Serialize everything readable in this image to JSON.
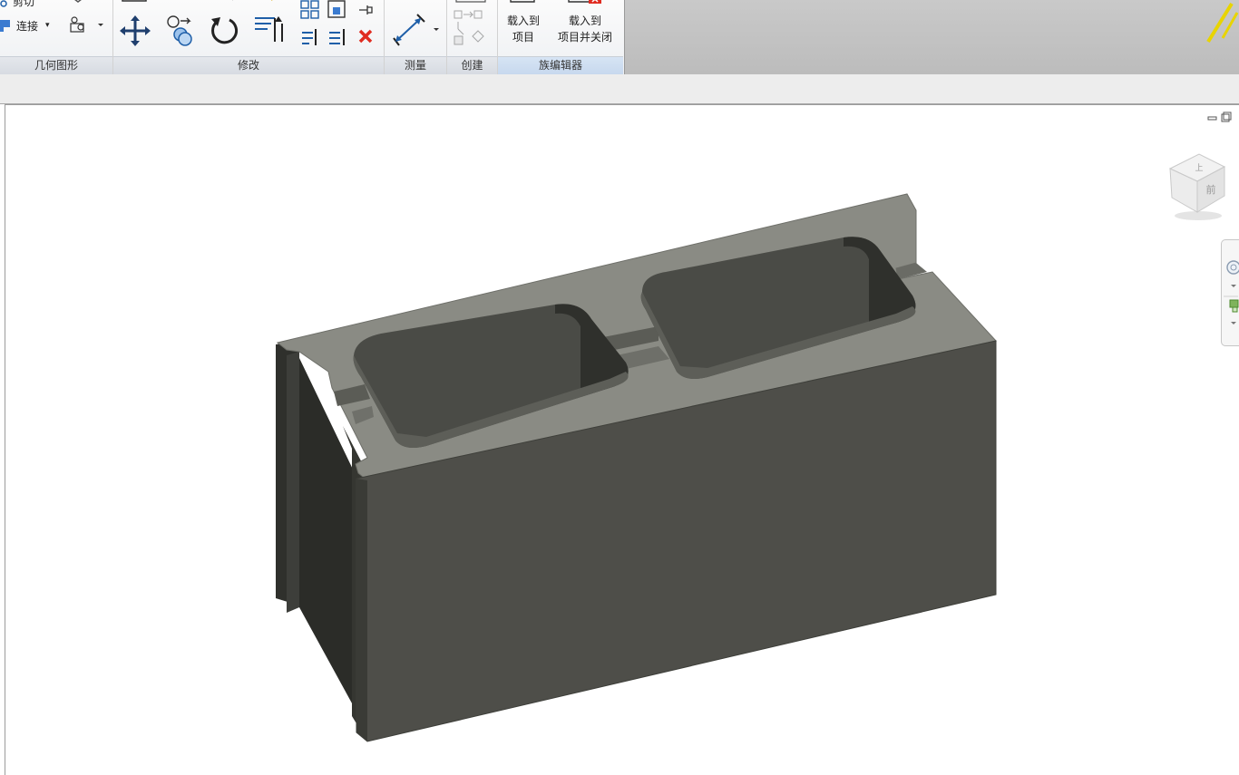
{
  "ribbon": {
    "geometry": {
      "cut_label": "剪切",
      "join_label": "连接",
      "title": "几何图形"
    },
    "modify": {
      "title": "修改"
    },
    "measure": {
      "title": "测量"
    },
    "create": {
      "title": "创建"
    },
    "family_editor": {
      "title": "族编辑器",
      "load_into_project": [
        "载入到",
        "项目"
      ],
      "load_into_project_close": [
        "载入到",
        "项目并关闭"
      ]
    }
  },
  "viewcube": {
    "top_label": "上",
    "front_label": "前"
  },
  "colors": {
    "block_top": "#8a8b84",
    "block_front": "#4e4e49",
    "block_side": "#2f302c",
    "cavity_wall": "#3c3d39",
    "delete_icon": "#e02c20",
    "ribbon_icon": "#1f5fa8"
  }
}
